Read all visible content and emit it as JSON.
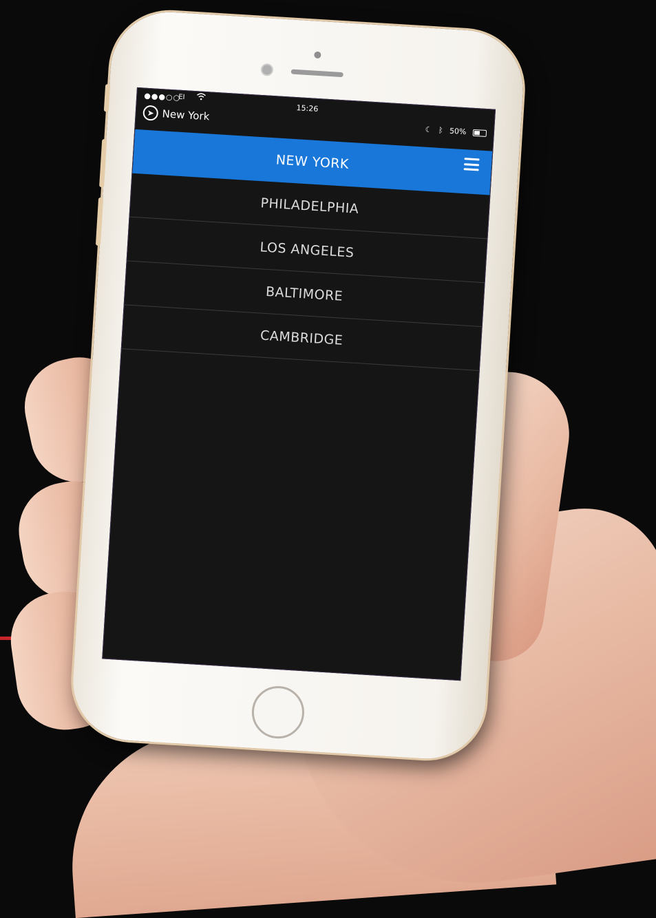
{
  "status_bar": {
    "signal": "●●●○○",
    "carrier": "EI",
    "wifi_icon": "wifi-icon",
    "time": "15:26",
    "battery": "50%",
    "moon_icon": "moon-icon",
    "bluetooth_icon": "bluetooth-icon"
  },
  "location": {
    "label": "New York",
    "icon": "navigation-arrow-icon"
  },
  "menu": {
    "items": [
      {
        "label": "NEW YORK",
        "active": true
      },
      {
        "label": "PHILADELPHIA",
        "active": false
      },
      {
        "label": "LOS ANGELES",
        "active": false
      },
      {
        "label": "BALTIMORE",
        "active": false
      },
      {
        "label": "CAMBRIDGE",
        "active": false
      }
    ],
    "menu_icon": "hamburger-icon"
  },
  "colors": {
    "accent": "#1877d8",
    "screen_bg": "#151515",
    "page_bg": "#0a0a0a",
    "stripe": "#c8242b"
  }
}
